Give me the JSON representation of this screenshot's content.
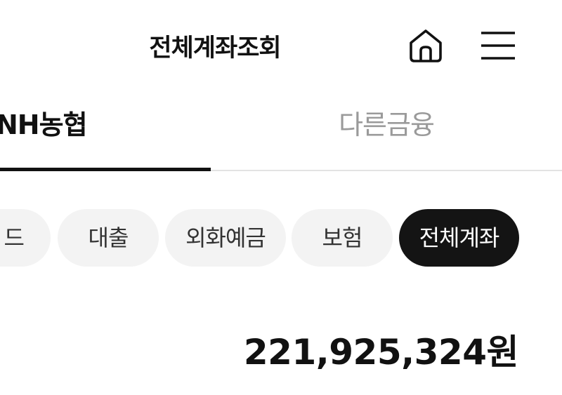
{
  "header": {
    "title": "전체계좌조회",
    "home_icon": "home-icon",
    "menu_icon": "hamburger-menu-icon"
  },
  "tabs": [
    {
      "label": "NH농협",
      "active": true
    },
    {
      "label": "다른금융",
      "active": false
    }
  ],
  "chips": [
    {
      "label": "드",
      "active": false
    },
    {
      "label": "대출",
      "active": false
    },
    {
      "label": "외화예금",
      "active": false
    },
    {
      "label": "보험",
      "active": false
    },
    {
      "label": "전체계좌",
      "active": true
    }
  ],
  "summary": {
    "total_amount": "221,925,324원"
  },
  "colors": {
    "text": "#111111",
    "inactive_tab": "#9a9a9a",
    "chip_bg": "#f3f3f3",
    "chip_active_bg": "#141414",
    "divider": "#e3e3e3"
  }
}
